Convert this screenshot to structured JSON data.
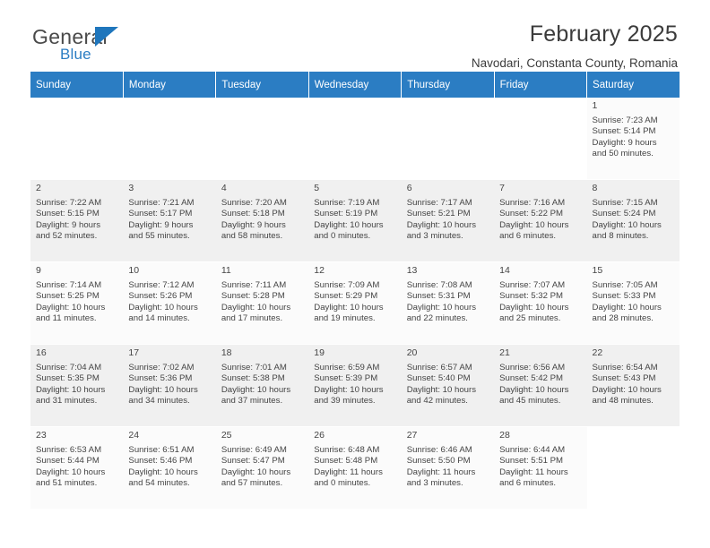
{
  "brand": {
    "general": "General",
    "blue": "Blue",
    "flag_icon": "triangle-flag-icon"
  },
  "header": {
    "month_title": "February 2025",
    "location": "Navodari, Constanta County, Romania"
  },
  "calendar": {
    "weekdays": [
      "Sunday",
      "Monday",
      "Tuesday",
      "Wednesday",
      "Thursday",
      "Friday",
      "Saturday"
    ],
    "accent_color": "#2b7dc3",
    "weeks": [
      [
        {
          "day": "",
          "lines": []
        },
        {
          "day": "",
          "lines": []
        },
        {
          "day": "",
          "lines": []
        },
        {
          "day": "",
          "lines": []
        },
        {
          "day": "",
          "lines": []
        },
        {
          "day": "",
          "lines": []
        },
        {
          "day": "1",
          "lines": [
            "Sunrise: 7:23 AM",
            "Sunset: 5:14 PM",
            "Daylight: 9 hours",
            "and 50 minutes."
          ]
        }
      ],
      [
        {
          "day": "2",
          "lines": [
            "Sunrise: 7:22 AM",
            "Sunset: 5:15 PM",
            "Daylight: 9 hours",
            "and 52 minutes."
          ]
        },
        {
          "day": "3",
          "lines": [
            "Sunrise: 7:21 AM",
            "Sunset: 5:17 PM",
            "Daylight: 9 hours",
            "and 55 minutes."
          ]
        },
        {
          "day": "4",
          "lines": [
            "Sunrise: 7:20 AM",
            "Sunset: 5:18 PM",
            "Daylight: 9 hours",
            "and 58 minutes."
          ]
        },
        {
          "day": "5",
          "lines": [
            "Sunrise: 7:19 AM",
            "Sunset: 5:19 PM",
            "Daylight: 10 hours",
            "and 0 minutes."
          ]
        },
        {
          "day": "6",
          "lines": [
            "Sunrise: 7:17 AM",
            "Sunset: 5:21 PM",
            "Daylight: 10 hours",
            "and 3 minutes."
          ]
        },
        {
          "day": "7",
          "lines": [
            "Sunrise: 7:16 AM",
            "Sunset: 5:22 PM",
            "Daylight: 10 hours",
            "and 6 minutes."
          ]
        },
        {
          "day": "8",
          "lines": [
            "Sunrise: 7:15 AM",
            "Sunset: 5:24 PM",
            "Daylight: 10 hours",
            "and 8 minutes."
          ]
        }
      ],
      [
        {
          "day": "9",
          "lines": [
            "Sunrise: 7:14 AM",
            "Sunset: 5:25 PM",
            "Daylight: 10 hours",
            "and 11 minutes."
          ]
        },
        {
          "day": "10",
          "lines": [
            "Sunrise: 7:12 AM",
            "Sunset: 5:26 PM",
            "Daylight: 10 hours",
            "and 14 minutes."
          ]
        },
        {
          "day": "11",
          "lines": [
            "Sunrise: 7:11 AM",
            "Sunset: 5:28 PM",
            "Daylight: 10 hours",
            "and 17 minutes."
          ]
        },
        {
          "day": "12",
          "lines": [
            "Sunrise: 7:09 AM",
            "Sunset: 5:29 PM",
            "Daylight: 10 hours",
            "and 19 minutes."
          ]
        },
        {
          "day": "13",
          "lines": [
            "Sunrise: 7:08 AM",
            "Sunset: 5:31 PM",
            "Daylight: 10 hours",
            "and 22 minutes."
          ]
        },
        {
          "day": "14",
          "lines": [
            "Sunrise: 7:07 AM",
            "Sunset: 5:32 PM",
            "Daylight: 10 hours",
            "and 25 minutes."
          ]
        },
        {
          "day": "15",
          "lines": [
            "Sunrise: 7:05 AM",
            "Sunset: 5:33 PM",
            "Daylight: 10 hours",
            "and 28 minutes."
          ]
        }
      ],
      [
        {
          "day": "16",
          "lines": [
            "Sunrise: 7:04 AM",
            "Sunset: 5:35 PM",
            "Daylight: 10 hours",
            "and 31 minutes."
          ]
        },
        {
          "day": "17",
          "lines": [
            "Sunrise: 7:02 AM",
            "Sunset: 5:36 PM",
            "Daylight: 10 hours",
            "and 34 minutes."
          ]
        },
        {
          "day": "18",
          "lines": [
            "Sunrise: 7:01 AM",
            "Sunset: 5:38 PM",
            "Daylight: 10 hours",
            "and 37 minutes."
          ]
        },
        {
          "day": "19",
          "lines": [
            "Sunrise: 6:59 AM",
            "Sunset: 5:39 PM",
            "Daylight: 10 hours",
            "and 39 minutes."
          ]
        },
        {
          "day": "20",
          "lines": [
            "Sunrise: 6:57 AM",
            "Sunset: 5:40 PM",
            "Daylight: 10 hours",
            "and 42 minutes."
          ]
        },
        {
          "day": "21",
          "lines": [
            "Sunrise: 6:56 AM",
            "Sunset: 5:42 PM",
            "Daylight: 10 hours",
            "and 45 minutes."
          ]
        },
        {
          "day": "22",
          "lines": [
            "Sunrise: 6:54 AM",
            "Sunset: 5:43 PM",
            "Daylight: 10 hours",
            "and 48 minutes."
          ]
        }
      ],
      [
        {
          "day": "23",
          "lines": [
            "Sunrise: 6:53 AM",
            "Sunset: 5:44 PM",
            "Daylight: 10 hours",
            "and 51 minutes."
          ]
        },
        {
          "day": "24",
          "lines": [
            "Sunrise: 6:51 AM",
            "Sunset: 5:46 PM",
            "Daylight: 10 hours",
            "and 54 minutes."
          ]
        },
        {
          "day": "25",
          "lines": [
            "Sunrise: 6:49 AM",
            "Sunset: 5:47 PM",
            "Daylight: 10 hours",
            "and 57 minutes."
          ]
        },
        {
          "day": "26",
          "lines": [
            "Sunrise: 6:48 AM",
            "Sunset: 5:48 PM",
            "Daylight: 11 hours",
            "and 0 minutes."
          ]
        },
        {
          "day": "27",
          "lines": [
            "Sunrise: 6:46 AM",
            "Sunset: 5:50 PM",
            "Daylight: 11 hours",
            "and 3 minutes."
          ]
        },
        {
          "day": "28",
          "lines": [
            "Sunrise: 6:44 AM",
            "Sunset: 5:51 PM",
            "Daylight: 11 hours",
            "and 6 minutes."
          ]
        },
        {
          "day": "",
          "lines": []
        }
      ]
    ]
  }
}
